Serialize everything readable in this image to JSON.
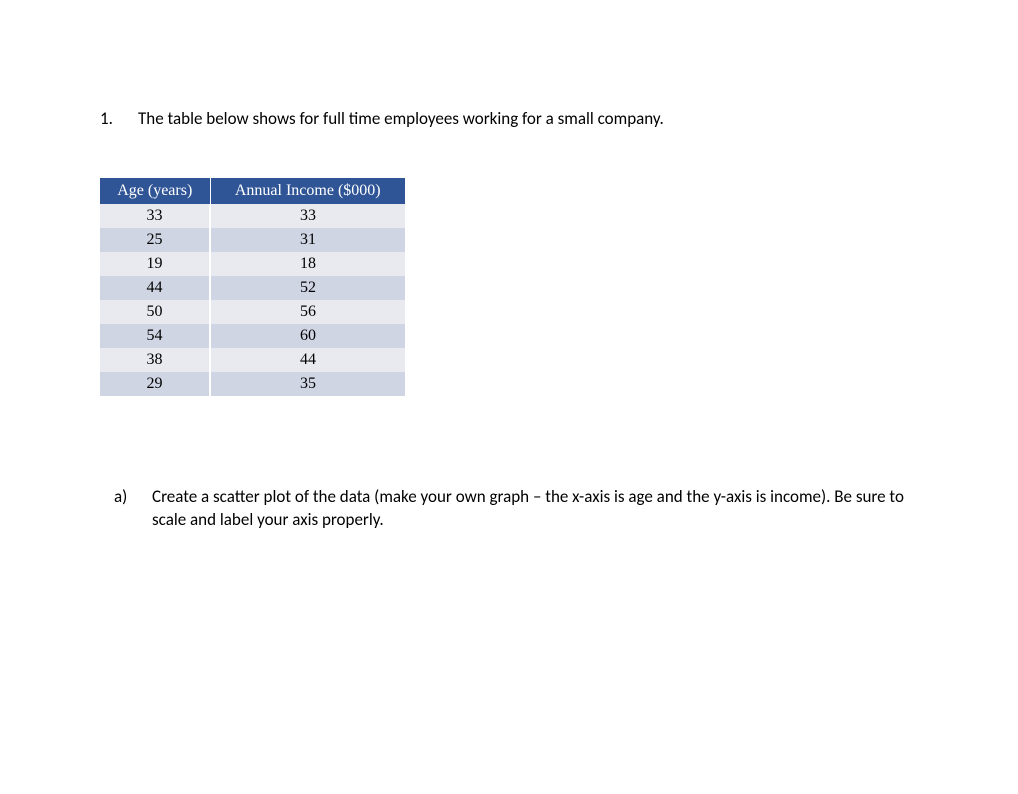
{
  "question": {
    "number": "1.",
    "text": "The table below shows for full time employees working for a small company."
  },
  "table": {
    "headers": {
      "age": "Age (years)",
      "income": "Annual Income ($000)"
    },
    "rows": [
      {
        "age": "33",
        "income": "33"
      },
      {
        "age": "25",
        "income": "31"
      },
      {
        "age": "19",
        "income": "18"
      },
      {
        "age": "44",
        "income": "52"
      },
      {
        "age": "50",
        "income": "56"
      },
      {
        "age": "54",
        "income": "60"
      },
      {
        "age": "38",
        "income": "44"
      },
      {
        "age": "29",
        "income": "35"
      }
    ]
  },
  "sub_question": {
    "label": "a)",
    "text": "Create a scatter plot of the data (make your own graph – the x-axis is age and the y-axis is income).  Be sure to scale and label your axis properly."
  },
  "chart_data": {
    "type": "table",
    "title": "",
    "columns": [
      "Age (years)",
      "Annual Income ($000)"
    ],
    "data": [
      [
        33,
        33
      ],
      [
        25,
        31
      ],
      [
        19,
        18
      ],
      [
        44,
        52
      ],
      [
        50,
        56
      ],
      [
        54,
        60
      ],
      [
        38,
        44
      ],
      [
        29,
        35
      ]
    ]
  }
}
